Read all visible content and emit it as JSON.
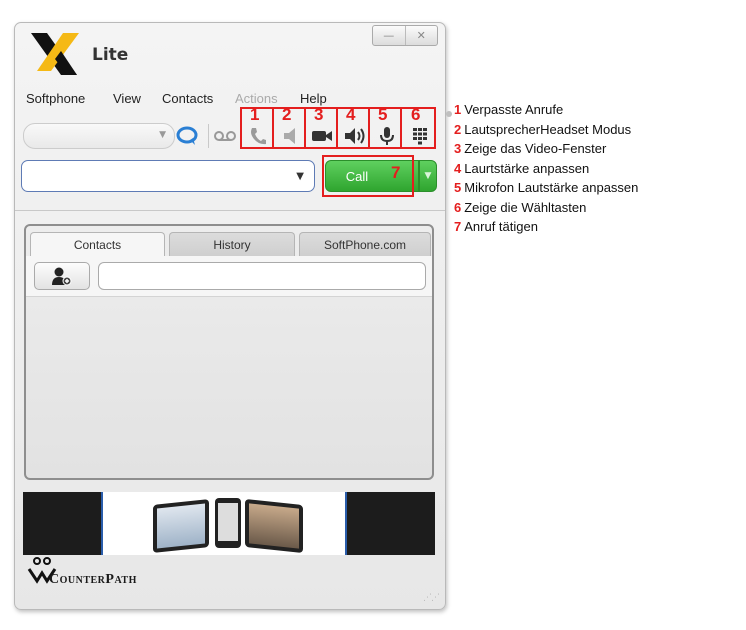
{
  "app": {
    "brand": "Lite",
    "logo_letter": "X"
  },
  "window_controls": {
    "minimize": "—",
    "close": "✕"
  },
  "menu": {
    "softphone": "Softphone",
    "view": "View",
    "contacts": "Contacts",
    "actions": "Actions",
    "help": "Help"
  },
  "toolbar": {
    "icons": [
      "chat-icon",
      "voicemail-icon",
      "phone-icon",
      "speaker-icon",
      "video-icon",
      "volume-icon",
      "microphone-icon",
      "keypad-icon"
    ]
  },
  "dial": {
    "value": "",
    "call_label": "Call"
  },
  "tabs": [
    {
      "label": "Contacts",
      "active": true
    },
    {
      "label": "History",
      "active": false
    },
    {
      "label": "SoftPhone.com",
      "active": false
    }
  ],
  "search": {
    "value": ""
  },
  "footer": {
    "company": "CounterPath"
  },
  "annotations": {
    "numbers": [
      "1",
      "2",
      "3",
      "4",
      "5",
      "6",
      "7"
    ],
    "legend": [
      {
        "num": "1",
        "text": "Verpasste Anrufe"
      },
      {
        "num": "2",
        "text": "LautsprecherHeadset Modus"
      },
      {
        "num": "3",
        "text": "Zeige das Video-Fenster"
      },
      {
        "num": "4",
        "text": "Laurtstärke anpassen"
      },
      {
        "num": "5",
        "text": "Mikrofon Lautstärke anpassen"
      },
      {
        "num": "6",
        "text": "Zeige die Wähltasten"
      },
      {
        "num": "7",
        "text": "Anruf tätigen"
      }
    ]
  },
  "colors": {
    "accent_red": "#e41e1e",
    "call_green": "#3cb83c",
    "link_blue": "#2a5dab"
  }
}
